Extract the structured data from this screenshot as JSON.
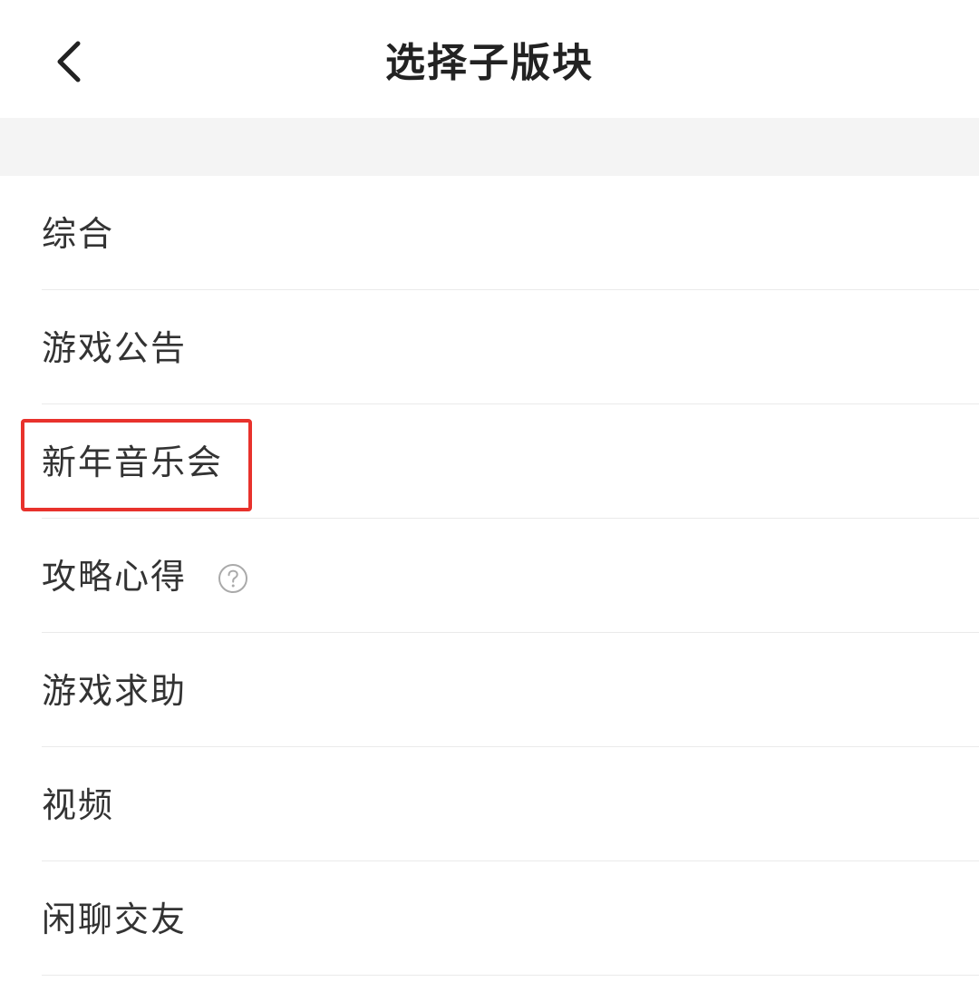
{
  "header": {
    "title": "选择子版块",
    "back_icon": "chevron-left-icon"
  },
  "colors": {
    "highlight": "#e8322c",
    "band": "#f4f4f4",
    "text": "#333333"
  },
  "items": [
    {
      "label": "综合"
    },
    {
      "label": "游戏公告"
    },
    {
      "label": "新年音乐会",
      "highlighted": true
    },
    {
      "label": "攻略心得",
      "icon": "help-circle-icon"
    },
    {
      "label": "游戏求助"
    },
    {
      "label": "视频"
    },
    {
      "label": "闲聊交友"
    }
  ]
}
